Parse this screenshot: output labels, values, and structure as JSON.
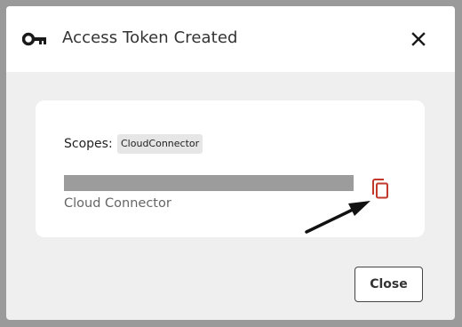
{
  "dialog": {
    "title": "Access Token Created",
    "icons": {
      "title_icon": "key-icon",
      "close_icon": "close-icon",
      "copy_icon": "copy-icon",
      "annotation": "pointer-arrow"
    }
  },
  "token": {
    "scopes_label": "Scopes:",
    "scope_chip": "CloudConnector",
    "name": "Cloud Connector",
    "value_redacted": true
  },
  "footer": {
    "close_label": "Close"
  },
  "colors": {
    "overlay": "#9a9a9a",
    "dialog_body": "#efefef",
    "copy_icon": "#c0392b",
    "token_bar": "#9c9c9c"
  }
}
